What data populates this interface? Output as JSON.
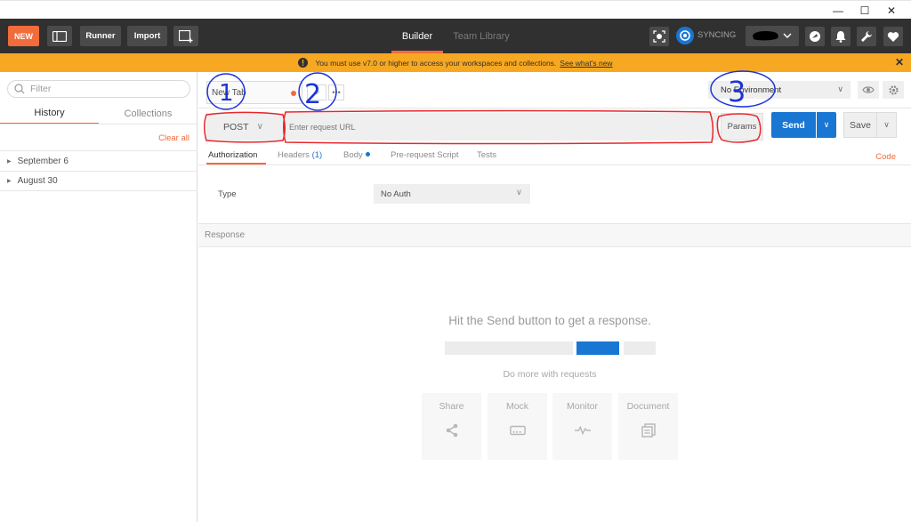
{
  "window": {
    "minimize": "—",
    "maximize": "☐",
    "close": "✕"
  },
  "toolbar": {
    "new_label": "NEW",
    "runner_label": "Runner",
    "import_label": "Import",
    "tabs": [
      {
        "label": "Builder",
        "active": true
      },
      {
        "label": "Team Library",
        "active": false
      }
    ],
    "syncing_label": "SYNCING"
  },
  "banner": {
    "message": "You must use v7.0 or higher to access your workspaces and collections.",
    "link": "See what's new",
    "close": "✕"
  },
  "sidebar": {
    "filter_placeholder": "Filter",
    "tabs": [
      {
        "label": "History",
        "active": true
      },
      {
        "label": "Collections",
        "active": false
      }
    ],
    "clear_all": "Clear all",
    "history": [
      {
        "label": "September 6"
      },
      {
        "label": "August 30"
      }
    ]
  },
  "request": {
    "tab_label": "New Tab",
    "new_tab_symbol": "+",
    "more_symbol": "•••",
    "environment": "No Environment",
    "method": "POST",
    "url_placeholder": "Enter request URL",
    "params_label": "Params",
    "send_label": "Send",
    "save_label": "Save",
    "subtabs": [
      {
        "label": "Authorization"
      },
      {
        "label": "Headers",
        "count": "(1)"
      },
      {
        "label": "Body"
      },
      {
        "label": "Pre-request Script"
      },
      {
        "label": "Tests"
      }
    ],
    "code_link": "Code",
    "type_label": "Type",
    "auth_type": "No Auth"
  },
  "response": {
    "section_label": "Response",
    "empty_message": "Hit the Send button to get a response.",
    "do_more": "Do more with requests",
    "actions": [
      {
        "label": "Share",
        "icon": "share-icon"
      },
      {
        "label": "Mock",
        "icon": "mock-icon"
      },
      {
        "label": "Monitor",
        "icon": "monitor-icon"
      },
      {
        "label": "Document",
        "icon": "document-icon"
      }
    ]
  },
  "annotations": [
    "1",
    "2",
    "3"
  ],
  "colors": {
    "accent": "#f26b3a",
    "primary": "#1976d2",
    "banner": "#f7a822",
    "toolbar": "#303030",
    "annotation_red": "#e8262b",
    "annotation_blue": "#1c34d6"
  }
}
